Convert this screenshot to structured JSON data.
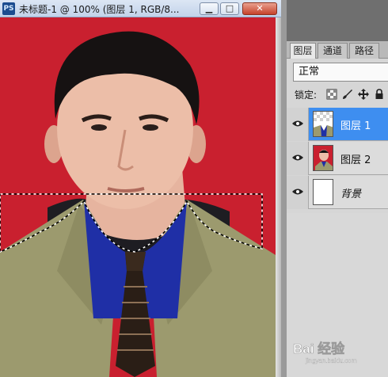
{
  "document": {
    "app_icon": "PS",
    "title": "未标题-1 @ 100% (图层 1, RGB/8...",
    "window_buttons": {
      "minimize": "▁",
      "maximize": "□",
      "close": "✕"
    }
  },
  "layers_panel": {
    "tabs": [
      {
        "label": "图层",
        "active": true
      },
      {
        "label": "通道",
        "active": false
      },
      {
        "label": "路径",
        "active": false
      }
    ],
    "blend_mode": "正常",
    "lock_label": "锁定:",
    "lock_icons": [
      "lock-transparency-icon",
      "lock-paint-icon",
      "lock-move-icon",
      "lock-all-icon"
    ],
    "layers": [
      {
        "name": "图层 1",
        "selected": true,
        "visible": true,
        "italic": false
      },
      {
        "name": "图层 2",
        "selected": false,
        "visible": true,
        "italic": false
      },
      {
        "name": "背景",
        "selected": false,
        "visible": true,
        "italic": true
      }
    ]
  },
  "watermark": {
    "text": "Bai 经验",
    "sub": "jingyan.baidu.com"
  },
  "colors": {
    "background_red": "#c9202f",
    "selection_blue": "#3e8ef0",
    "suit": "#9c9a6e",
    "shirt": "#1f2fa6"
  }
}
